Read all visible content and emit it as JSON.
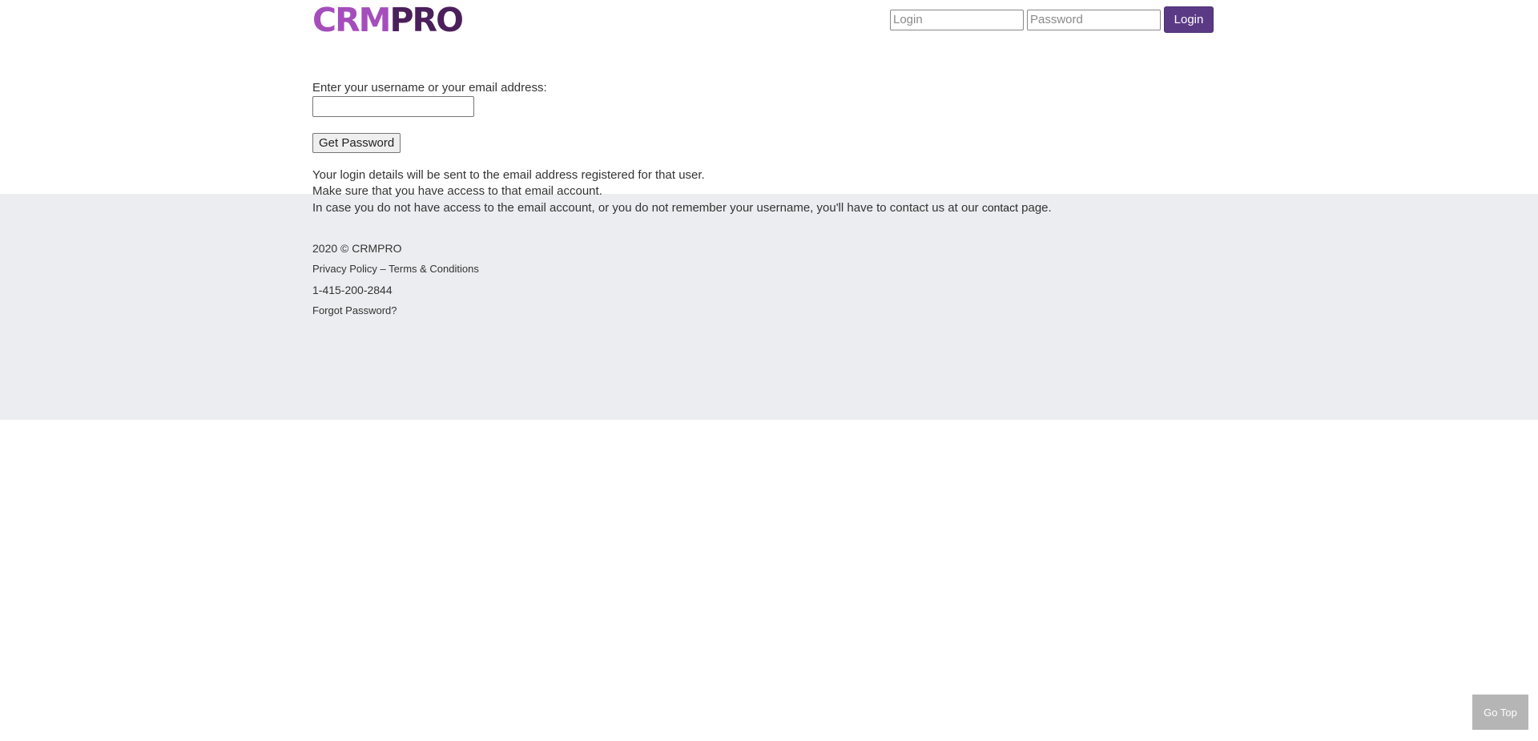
{
  "header": {
    "logo_part1": "CRM",
    "logo_part2": "PRO",
    "login_placeholder": "Login",
    "password_placeholder": "Password",
    "login_button": "Login"
  },
  "main": {
    "field_label": "Enter your username or your email address:",
    "field_value": "",
    "submit_button": "Get Password",
    "info_line1": "Your login details will be sent to the email address registered for that user.",
    "info_line2": "Make sure that you have access to that email account.",
    "info_line3_before": "In case you do not have access to the email account, or you do not remember your username, you'll have to contact us at our ",
    "info_line3_link": "contact",
    "info_line3_after": " page."
  },
  "footer": {
    "copyright": "2020 © CRMPRO",
    "privacy_link": "Privacy Policy",
    "separator": " – ",
    "terms_link": "Terms & Conditions",
    "phone": "1-415-200-2844",
    "forgot_link": "Forgot Password?"
  },
  "go_top": {
    "label": "Go Top"
  },
  "colors": {
    "logo_crm": "#a54dbc",
    "logo_pro": "#4b1f5b",
    "login_button_bg": "#5b3a85",
    "footer_bg": "#ecedf0",
    "go_top_bg": "#b5b5b5"
  }
}
